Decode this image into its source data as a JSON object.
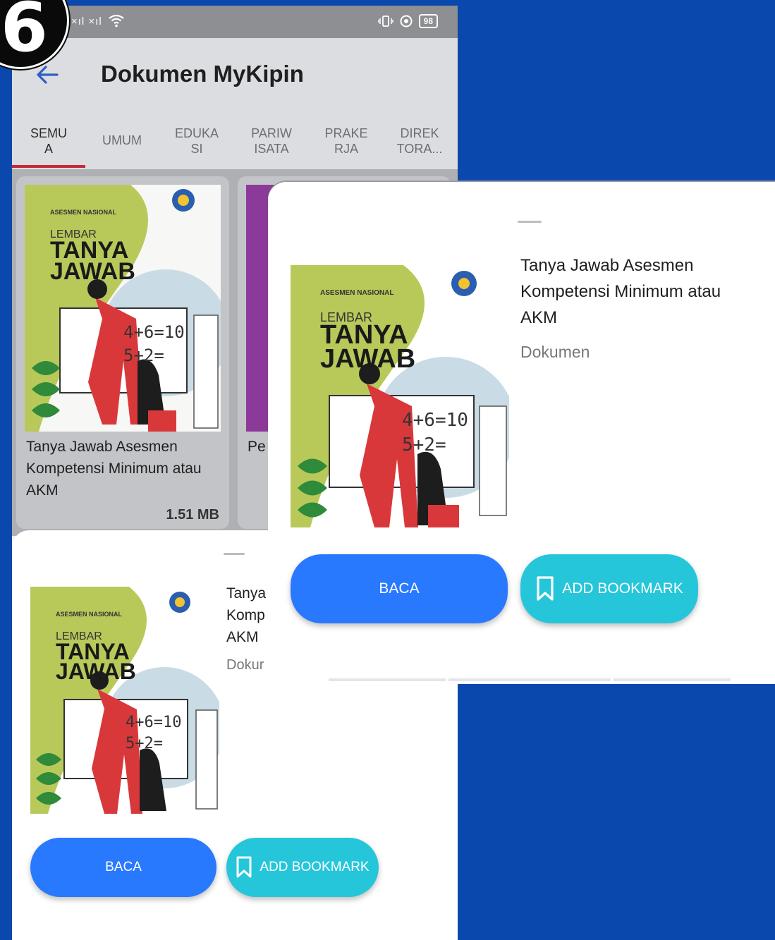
{
  "step_badge": "6",
  "status_bar": {
    "signal": "×ıl ×ıl",
    "battery": "98"
  },
  "app_bar": {
    "title": "Dokumen MyKipin"
  },
  "tabs": [
    {
      "label": "SEMU\nA"
    },
    {
      "label": "UMUM"
    },
    {
      "label": "EDUKA\nSI"
    },
    {
      "label": "PARIW\nISATA"
    },
    {
      "label": "PRAKE\nRJA"
    },
    {
      "label": "DIREK\nTORA..."
    }
  ],
  "cards": [
    {
      "title": "Tanya Jawab Asesmen Kompetensi Minimum atau AKM",
      "size": "1.51 MB"
    },
    {
      "title": "Pe"
    }
  ],
  "cover": {
    "heading": "ASESMEN NASIONAL",
    "lembar": "LEMBAR",
    "tanya": "TANYA",
    "jawab": "JAWAB",
    "math1": "4+6=10",
    "math2": "5+2="
  },
  "sheet_lower": {
    "title_lines": [
      "Tanya",
      "Komp",
      "AKM"
    ],
    "type_label": "Dokur",
    "read_button": "BACA",
    "bookmark_button": "ADD BOOKMARK"
  },
  "sheet_upper": {
    "title": "Tanya Jawab Asesmen Kompetensi Minimum atau AKM",
    "type_label": "Dokumen",
    "read_button": "BACA",
    "bookmark_button": "ADD BOOKMARK"
  },
  "colors": {
    "background": "#0a48ad",
    "primary_button": "#2979ff",
    "accent_button": "#26c6da",
    "tab_indicator": "#c62838"
  }
}
